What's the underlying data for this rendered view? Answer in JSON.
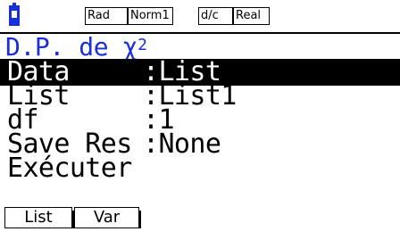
{
  "status_bar": {
    "angle": "Rad",
    "display": "Norm1",
    "fraction": "d/c",
    "complex": "Real"
  },
  "title": {
    "text": "D.P. de χ",
    "superscript": "2"
  },
  "rows": [
    {
      "label": "Data",
      "value": ":List",
      "selected": true
    },
    {
      "label": "List",
      "value": ":List1"
    },
    {
      "label": "df",
      "value": ":1"
    },
    {
      "label": "Save Res",
      "value": ":None"
    },
    {
      "label": "Exécuter",
      "value": ""
    }
  ],
  "function_keys": [
    {
      "label": "List"
    },
    {
      "label": "Var"
    }
  ],
  "colors": {
    "accent": "#1a2fd6",
    "text": "#000000",
    "selected_bg": "#000000",
    "selected_text": "#ffffff"
  }
}
